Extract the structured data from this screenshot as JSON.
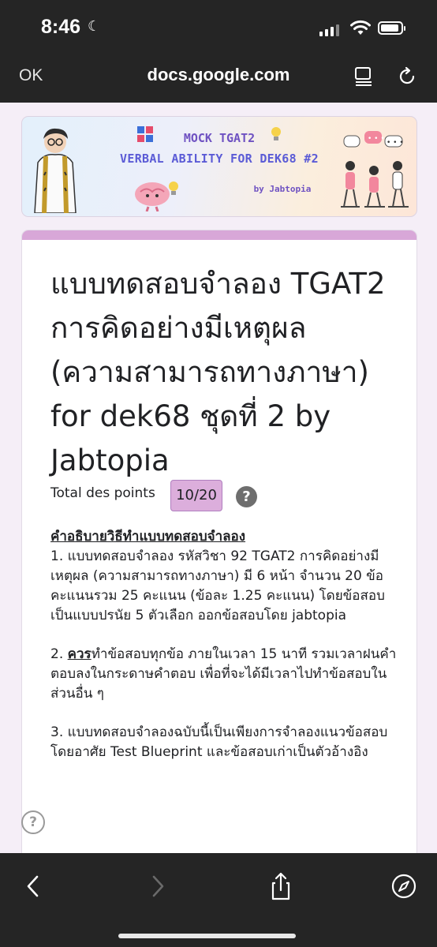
{
  "status_bar": {
    "time": "8:46",
    "moon_glyph": "☾"
  },
  "browser": {
    "ok_label": "OK",
    "url": "docs.google.com"
  },
  "banner": {
    "line1": "MOCK TGAT2",
    "line2": "VERBAL ABILITY FOR DEK68 #2",
    "line3": "by Jabtopia"
  },
  "form": {
    "accent_color": "#d8a7d8",
    "title": "แบบทดสอบจำลอง TGAT2 การคิดอย่างมีเหตุผล (ความสามารถทางภาษา) for dek68 ชุดที่ 2 by Jabtopia",
    "points_label": "Total des points",
    "points_score": "10/20",
    "help_glyph": "?",
    "description": {
      "heading": "คำอธิบายวิธีทำแบบทดสอบจำลอง",
      "item1": "1. แบบทดสอบจำลอง รหัสวิชา 92 TGAT2 การคิดอย่างมีเหตุผล (ความสามารถทางภาษา) มี 6 หน้า จำนวน 20 ข้อ คะแนนรวม 25 คะแนน (ข้อละ 1.25 คะแนน) โดยข้อสอบเป็นแบบปรนัย 5 ตัวเลือก ออกข้อสอบโดย jabtopia",
      "item2_prefix": "2. ",
      "item2_bold": "ควร",
      "item2_rest": "ทำข้อสอบทุกข้อ ภายในเวลา 15 นาที รวมเวลาฝนคำตอบลงในกระดาษคำตอบ เพื่อที่จะได้มีเวลาไปทำข้อสอบในส่วนอื่น ๆ",
      "item3": "3. แบบทดสอบจำลองฉบับนี้เป็นเพียงการจำลองแนวข้อสอบ โดยอาศัย Test Blueprint และข้อสอบเก่าเป็นตัวอ้างอิง"
    }
  },
  "floating_help_glyph": "?"
}
